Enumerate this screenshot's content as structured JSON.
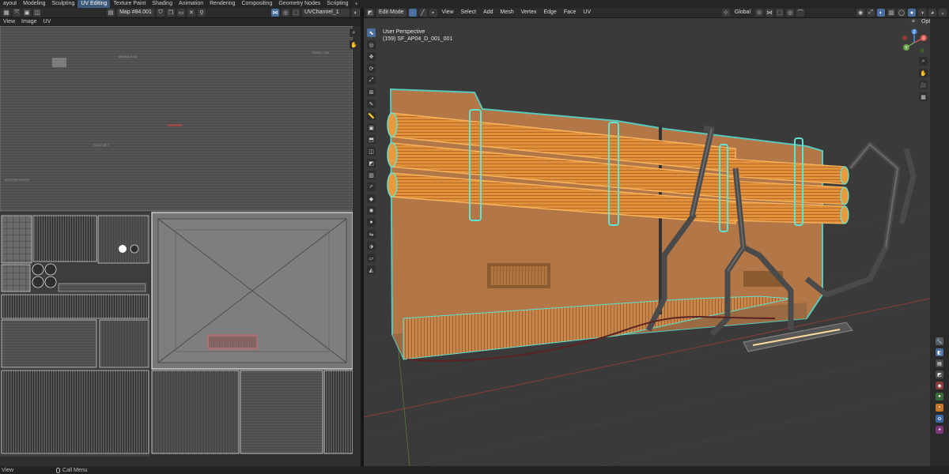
{
  "workspace_tabs": [
    "ayout",
    "Modeling",
    "Sculpting",
    "UV Editing",
    "Texture Paint",
    "Shading",
    "Animation",
    "Rendering",
    "Compositing",
    "Geometry Nodes",
    "Scripting"
  ],
  "workspace_add": "+",
  "uv_editor": {
    "view_label": "View",
    "image_label": "Image",
    "uv_label": "UV",
    "image_name": "Map #84.001",
    "uv_channel": "UVChannel_1",
    "texture_labels": [
      "MODULE-03",
      "PANEL 24B",
      "SECTOR 7",
      "ACCESS HATCH"
    ]
  },
  "viewport": {
    "mode": "Edit Mode",
    "menus": [
      "View",
      "Select",
      "Add",
      "Mesh",
      "Vertex",
      "Edge",
      "Face",
      "UV"
    ],
    "orientation": "Global",
    "perspective_label": "User Perspective",
    "object_label": "(159) SF_AP04_D_001_001",
    "options_label": "Options",
    "gizmo_x": "X",
    "gizmo_y": "Y",
    "gizmo_z": "Z"
  },
  "status_bar": {
    "items": [
      "View",
      "Call Menu"
    ]
  },
  "colors": {
    "accent": "#4a6f9c",
    "selection_orange": "#e89a3c",
    "wire_cyan": "#54e0d0"
  }
}
